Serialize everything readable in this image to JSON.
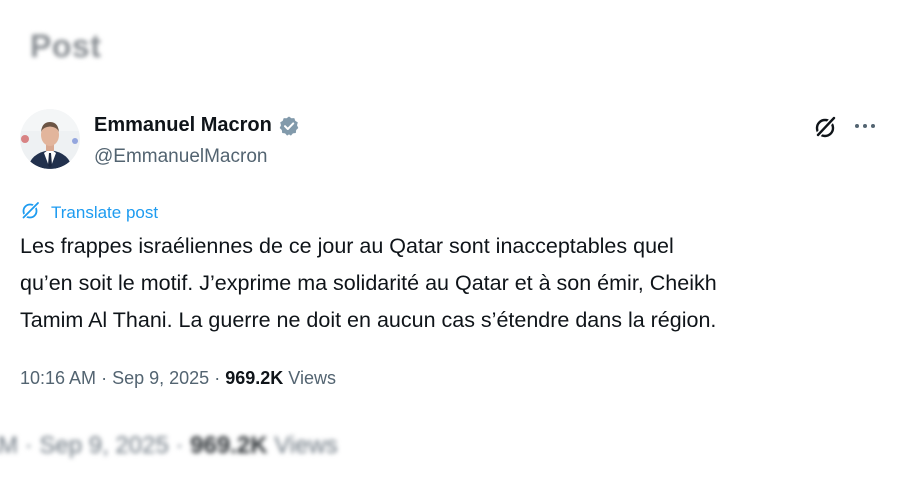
{
  "page": {
    "title": "Post"
  },
  "post": {
    "author_name": "Emmanuel Macron",
    "handle": "@EmmanuelMacron",
    "verified": true,
    "translate_label": "Translate post",
    "body_lines": [
      "Les frappes israéliennes de ce jour au Qatar sont inacceptables quel",
      "qu’en soit le motif. J’exprime ma solidarité au Qatar et à son émir, Cheikh",
      "Tamim Al Thani. La guerre ne doit en aucun cas s’étendre dans la région."
    ],
    "time": "10:16 AM",
    "date": "Sep 9, 2025",
    "views_count": "969.2K",
    "views_label": "Views",
    "separator": "·"
  },
  "blurred_meta": {
    "time": "AM",
    "date": "Sep 9, 2025",
    "views_count": "969.2K",
    "views_label": "Views"
  },
  "icons": {
    "verified": "verified-badge-icon",
    "grok": "grok-icon",
    "more": "more-icon",
    "translate": "translate-icon"
  },
  "colors": {
    "link": "#1d9bf0",
    "text": "#0f1419",
    "secondary": "#536471",
    "muted_title": "#8a8f94"
  }
}
